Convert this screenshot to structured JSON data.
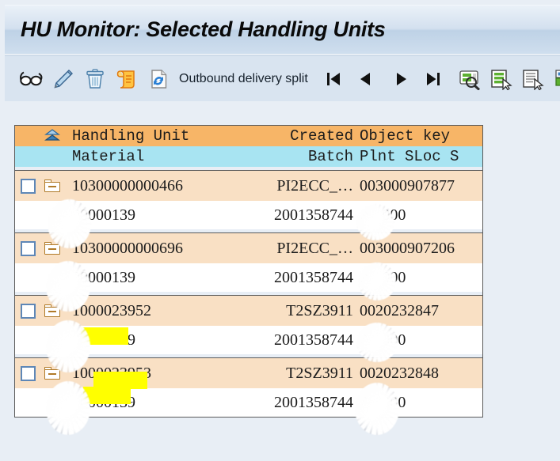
{
  "window": {
    "title": "HU Monitor: Selected Handling Units"
  },
  "toolbar": {
    "icons": [
      {
        "name": "glasses-display-icon",
        "label": "Display"
      },
      {
        "name": "pencil-edit-icon",
        "label": "Change"
      },
      {
        "name": "trash-delete-icon",
        "label": "Delete"
      },
      {
        "name": "scroll-log-icon",
        "label": "Log"
      },
      {
        "name": "refresh-document-icon",
        "label": "Refresh"
      }
    ],
    "split_button_label": "Outbound delivery split",
    "nav": [
      {
        "name": "first-page-icon",
        "label": "First"
      },
      {
        "name": "previous-page-icon",
        "label": "Previous"
      },
      {
        "name": "next-page-icon",
        "label": "Next"
      },
      {
        "name": "last-page-icon",
        "label": "Last"
      }
    ],
    "right_icons": [
      {
        "name": "find-icon",
        "label": "Find"
      },
      {
        "name": "select-layout-icon",
        "label": "Select Layout"
      },
      {
        "name": "detail-list-icon",
        "label": "Detail"
      },
      {
        "name": "export-icon",
        "label": "Export"
      }
    ]
  },
  "table": {
    "header_primary": {
      "hierarchy_icon": "hierarchy-icon",
      "col_handling_unit": "Handling Unit",
      "col_created": "Created",
      "col_object_key": "Object key"
    },
    "header_secondary": {
      "col_material": "Material",
      "col_batch": "Batch",
      "col_plant_sloc": "Plnt SLoc S"
    },
    "rows": [
      {
        "handling_unit": "10300000000466",
        "created": "PI2ECC_…",
        "object_key": "003000907877",
        "material": "00000139",
        "batch": "2001358744",
        "plant_sloc": "A 1000",
        "highlighted": false,
        "selected": false
      },
      {
        "handling_unit": "10300000000696",
        "created": "PI2ECC_…",
        "object_key": "003000907206",
        "material": "00000139",
        "batch": "2001358744",
        "plant_sloc": "A 1000",
        "highlighted": false,
        "selected": false
      },
      {
        "handling_unit": "1000023952",
        "created": "T2SZ3911",
        "object_key": "0020232847",
        "material": "00000139",
        "batch": "2001358744",
        "plant_sloc": "A 1000",
        "highlighted": true,
        "selected": false
      },
      {
        "handling_unit": "1000023953",
        "created": "T2SZ3911",
        "object_key": "0020232848",
        "material": "00000139",
        "batch": "2001358744",
        "plant_sloc": "A 1000",
        "highlighted": true,
        "selected": false
      }
    ]
  },
  "colors": {
    "header_primary_bg": "#f7b567",
    "header_secondary_bg": "#a8e4f2",
    "row_top_bg": "#f9e0c4",
    "row_bottom_bg": "#ffffff",
    "highlight": "#ffff00",
    "titlebar_bg": "#cfdeee",
    "toolbar_bg": "#d9e4f0",
    "page_bg": "#e8eef5"
  }
}
